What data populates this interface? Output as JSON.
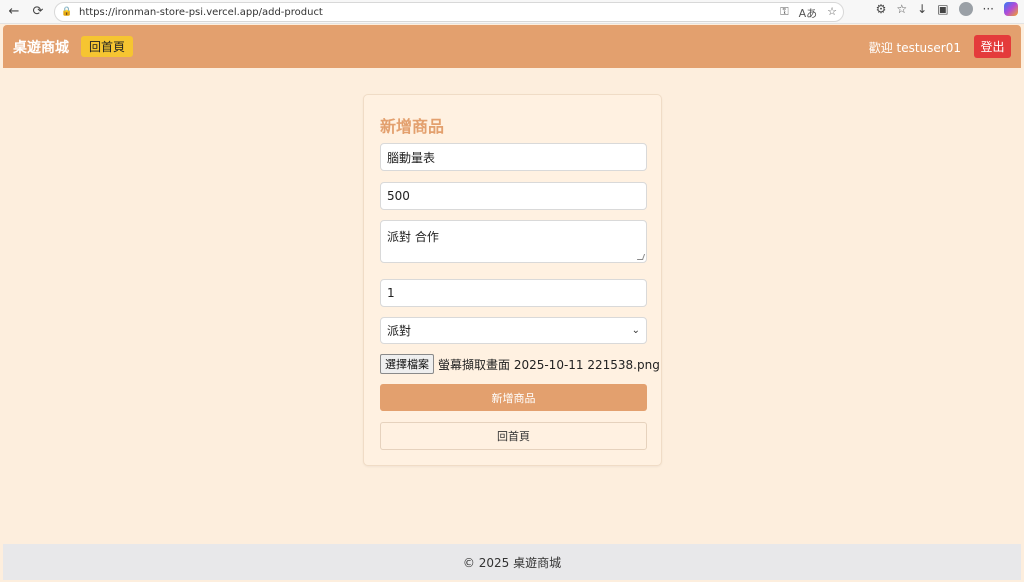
{
  "browser": {
    "url": "https://ironman-store-psi.vercel.app/add-product",
    "icons": {
      "back": "arrow-left-icon",
      "reload": "reload-icon"
    }
  },
  "nav": {
    "brand": "桌遊商城",
    "home_button": "回首頁",
    "welcome": "歡迎 testuser01",
    "logout": "登出"
  },
  "form": {
    "title": "新增商品",
    "name_value": "腦動量表",
    "price_value": "500",
    "description_value": "派對 合作",
    "stock_value": "1",
    "category_selected": "派對",
    "file_button": "選擇檔案",
    "file_name": "螢幕擷取畫面 2025-10-11 221538.png",
    "submit_label": "新增商品",
    "back_label": "回首頁"
  },
  "footer": {
    "text": "© 2025 桌遊商城"
  },
  "colors": {
    "accent": "#e3a06e",
    "page_bg": "#fdeedd",
    "home_btn": "#f6c531",
    "logout_btn": "#e43b3b"
  }
}
